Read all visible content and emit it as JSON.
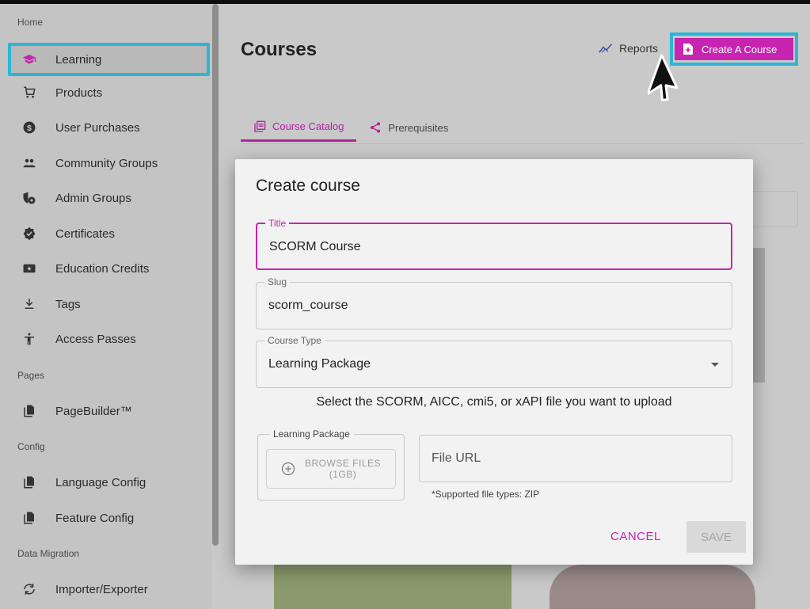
{
  "sidebar": {
    "sections": {
      "home": "Home",
      "pages": "Pages",
      "config": "Config",
      "data_migration": "Data Migration"
    },
    "items": [
      {
        "label": "Learning",
        "icon": "graduation-cap-icon"
      },
      {
        "label": "Products",
        "icon": "cart-icon"
      },
      {
        "label": "User Purchases",
        "icon": "dollar-icon"
      },
      {
        "label": "Community Groups",
        "icon": "people-icon"
      },
      {
        "label": "Admin Groups",
        "icon": "admin-group-icon"
      },
      {
        "label": "Certificates",
        "icon": "badge-icon"
      },
      {
        "label": "Education Credits",
        "icon": "credits-icon"
      },
      {
        "label": "Tags",
        "icon": "tag-icon"
      },
      {
        "label": "Access Passes",
        "icon": "person-icon"
      },
      {
        "label": "PageBuilder™",
        "icon": "pages-icon"
      },
      {
        "label": "Language Config",
        "icon": "pages-icon"
      },
      {
        "label": "Feature Config",
        "icon": "pages-icon"
      },
      {
        "label": "Importer/Exporter",
        "icon": "sync-icon"
      }
    ],
    "active_color": "#2bb6d6"
  },
  "header": {
    "title": "Courses",
    "reports_label": "Reports",
    "create_label": "Create A Course",
    "accent": "#c724b1"
  },
  "tabs": [
    {
      "label": "Course Catalog",
      "icon": "catalog-icon"
    },
    {
      "label": "Prerequisites",
      "icon": "share-icon"
    }
  ],
  "modal": {
    "title": "Create course",
    "title_field": {
      "label": "Title",
      "value": "SCORM Course"
    },
    "slug_field": {
      "label": "Slug",
      "value": "scorm_course"
    },
    "type_field": {
      "label": "Course Type",
      "value": "Learning Package"
    },
    "upload_hint": "Select the SCORM, AICC, cmi5, or xAPI file you want to upload",
    "package": {
      "label": "Learning Package",
      "browse_line1": "BROWSE FILES",
      "browse_line2": "(1GB)"
    },
    "url_field": {
      "placeholder": "File URL"
    },
    "supported": "*Supported file types: ZIP",
    "cancel_label": "CANCEL",
    "save_label": "SAVE"
  }
}
